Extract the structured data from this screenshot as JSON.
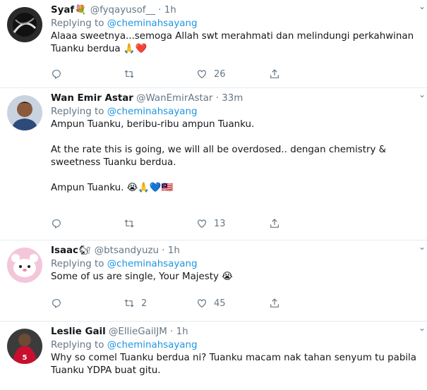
{
  "reply_prefix": "Replying to",
  "tweets": [
    {
      "name": "Syaf",
      "name_emoji": "💐",
      "handle": "@fyqayusof__",
      "dot": "·",
      "time": "1h",
      "replying_to": "@cheminahsayang",
      "text": "Alaaa sweetnya...semoga Allah swt merahmati dan melindungi perkahwinan Tuanku berdua 🙏❤️",
      "replies": "",
      "retweets": "",
      "likes": "26"
    },
    {
      "name": "Wan Emir Astar",
      "name_emoji": "",
      "handle": "@WanEmirAstar",
      "dot": "·",
      "time": "33m",
      "replying_to": "@cheminahsayang",
      "text": "Ampun Tuanku, beribu-ribu ampun Tuanku.\n\nAt the rate this is going, we will all be overdosed.. dengan chemistry & sweetness Tuanku berdua.\n\nAmpun Tuanku. 😭🙏💙🇲🇾",
      "replies": "",
      "retweets": "",
      "likes": "13"
    },
    {
      "name": "Isaac",
      "name_emoji": "🐿",
      "handle": "@btsandyuzu",
      "dot": "·",
      "time": "1h",
      "replying_to": "@cheminahsayang",
      "text": "Some of us are single, Your Majesty 😭",
      "replies": "",
      "retweets": "2",
      "likes": "45"
    },
    {
      "name": "Leslie Gail",
      "name_emoji": "",
      "handle": "@EllieGailJM",
      "dot": "·",
      "time": "1h",
      "replying_to": "@cheminahsayang",
      "text": "Why so comel Tuanku berdua ni? Tuanku macam nak tahan senyum tu pabila Tuanku YDPA buat gitu.",
      "replies": "",
      "retweets": "",
      "likes": ""
    }
  ],
  "icons": {
    "caret": "chevron-down-icon",
    "reply": "reply-icon",
    "retweet": "retweet-icon",
    "like": "heart-icon",
    "share": "share-icon"
  },
  "colors": {
    "link": "#1b95e0",
    "muted": "#657786",
    "text": "#14171a",
    "divider": "#e6ecf0"
  }
}
